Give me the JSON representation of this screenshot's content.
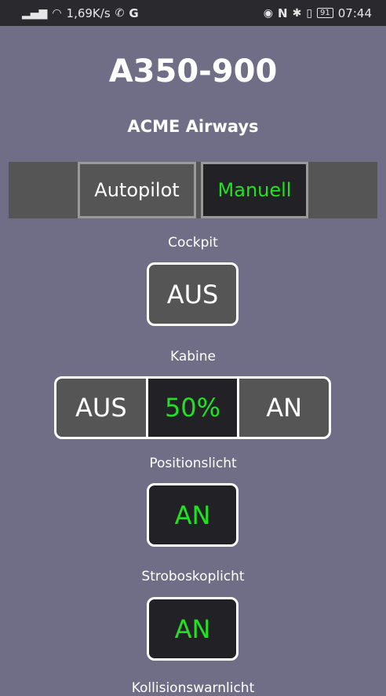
{
  "status_bar": {
    "signal_icon": "signal-icon",
    "wifi_icon": "wifi-icon",
    "speed": "1,69K/s",
    "call_icon": "call-icon",
    "g_label": "G",
    "eye_icon": "eye-icon",
    "nfc_label": "N",
    "bluetooth_icon": "bluetooth-icon",
    "vibrate_icon": "vibrate-icon",
    "battery": "91",
    "time": "07:44"
  },
  "header": {
    "title": "A350-900",
    "subtitle": "ACME Airways"
  },
  "mode": {
    "autopilot_label": "Autopilot",
    "manuell_label": "Manuell",
    "active": "Manuell"
  },
  "controls": {
    "cockpit": {
      "label": "Cockpit",
      "value": "AUS"
    },
    "kabine": {
      "label": "Kabine",
      "options": [
        "AUS",
        "50%",
        "AN"
      ],
      "selected": "50%"
    },
    "positionslicht": {
      "label": "Positionslicht",
      "value": "AN"
    },
    "stroboskoplicht": {
      "label": "Stroboskoplicht",
      "value": "AN"
    },
    "next_label": "Kollisionswarnlicht"
  },
  "colors": {
    "background": "#6f6e86",
    "active_text": "#22e022",
    "off_bg": "#555555",
    "on_bg": "#222226"
  }
}
